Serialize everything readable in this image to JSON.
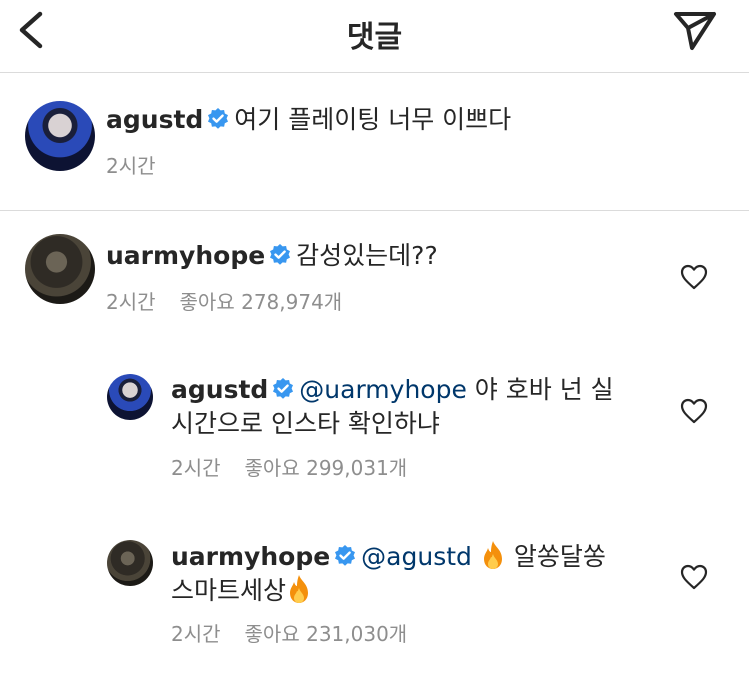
{
  "header": {
    "title": "댓글"
  },
  "caption": {
    "username": "agustd",
    "text": "여기 플레이팅 너무 이쁘다",
    "time": "2시간"
  },
  "comments": [
    {
      "username": "uarmyhope",
      "text": "감성있는데??",
      "time": "2시간",
      "likes": "좋아요 278,974개"
    }
  ],
  "replies": [
    {
      "username": "agustd",
      "mention": "@uarmyhope",
      "text_line1": "야 호바 넌 실",
      "text_line2": "시간으로 인스타 확인하냐",
      "time": "2시간",
      "likes": "좋아요 299,031개"
    },
    {
      "username": "uarmyhope",
      "mention": "@agustd",
      "emoji": "🔥",
      "text_line1": "알쏭달쏭",
      "text_line2": "스마트세상",
      "time": "2시간",
      "likes": "좋아요 231,030개"
    }
  ],
  "icons": {
    "back": "chevron-left",
    "send": "paper-plane",
    "verified": "verified-badge",
    "like": "heart-outline",
    "fire": "fire-emoji"
  },
  "colors": {
    "verified": "#3897f0",
    "mention": "#00376b",
    "meta": "#8e8e8e",
    "divider": "#dbdbdb"
  }
}
